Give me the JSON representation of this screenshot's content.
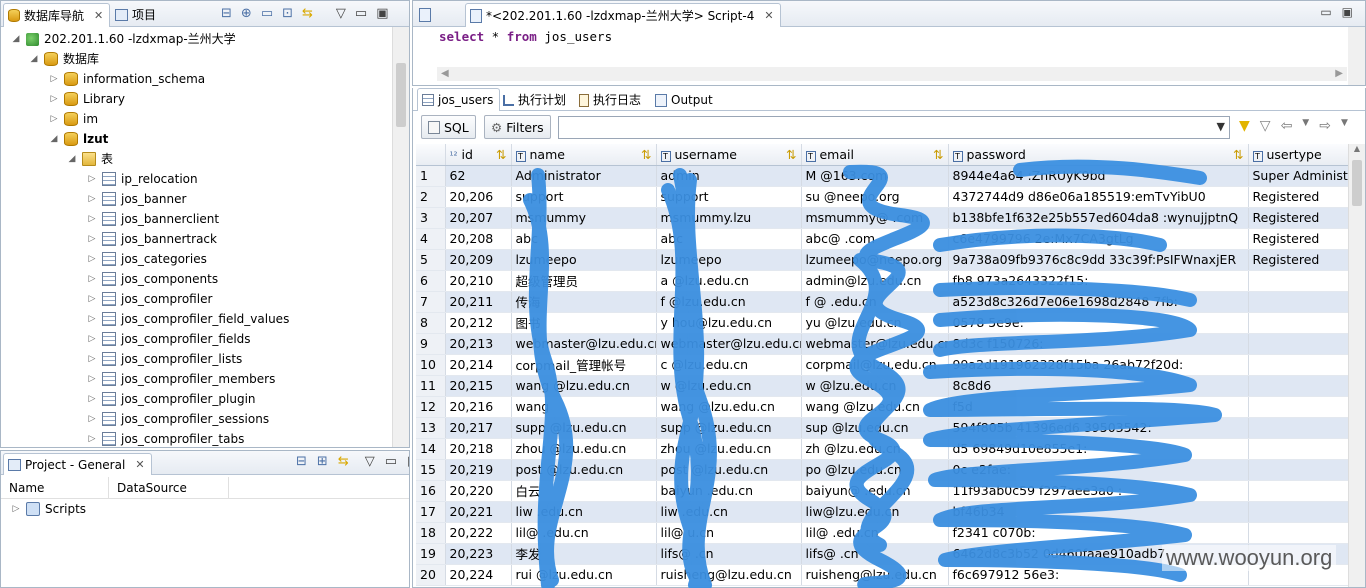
{
  "nav": {
    "tab1": "数据库导航",
    "tab2": "项目",
    "connection": "202.201.1.60 -lzdxmap-兰州大学",
    "databases_folder": "数据库",
    "dbs": [
      "information_schema",
      "Library",
      "im",
      "lzut"
    ],
    "tables_folder": "表",
    "tables": [
      "ip_relocation",
      "jos_banner",
      "jos_bannerclient",
      "jos_bannertrack",
      "jos_categories",
      "jos_components",
      "jos_comprofiler",
      "jos_comprofiler_field_values",
      "jos_comprofiler_fields",
      "jos_comprofiler_lists",
      "jos_comprofiler_members",
      "jos_comprofiler_plugin",
      "jos_comprofiler_sessions",
      "jos_comprofiler_tabs"
    ]
  },
  "project": {
    "title": "Project - General",
    "col_name": "Name",
    "col_ds": "DataSource",
    "item": "Scripts"
  },
  "editor": {
    "tab": "*<202.201.1.60 -lzdxmap-兰州大学> Script-4",
    "sql_kw1": "select",
    "sql_mid": " * ",
    "sql_kw2": "from",
    "sql_tbl": " jos_users"
  },
  "result_tabs": [
    "jos_users",
    "执行计划",
    "执行日志",
    "Output"
  ],
  "toolbar": {
    "sql": "SQL",
    "filters": "Filters"
  },
  "grid": {
    "columns": [
      "id",
      "name",
      "username",
      "email",
      "password",
      "usertype"
    ],
    "rows": [
      [
        "1",
        "62",
        "Administrator",
        "admin",
        "M         @163.com",
        "8944e4a64          :ZnRUyK9bd",
        "Super Administra"
      ],
      [
        "2",
        "20,206",
        "support",
        "support",
        "su       @neepo.org",
        "4372744d9         d86e06a185519:emTvYibU0",
        "Registered"
      ],
      [
        "3",
        "20,207",
        "msmummy",
        "msmummy.lzu",
        "msmummy@      .com",
        "b138bfe1f632e25b557ed604da8     :wynujjptnQ",
        "Registered"
      ],
      [
        "4",
        "20,208",
        "abc",
        "abc",
        "abc@     .com",
        "c6e4799796    2e:Mx7CA3gtLg",
        "Registered"
      ],
      [
        "5",
        "20,209",
        "lzumeepo",
        "lzumeepo",
        "lzumeepo@neepo.org",
        "9a738a09fb9376c8c9dd    33c39f:PsIFWnaxjER",
        "Registered"
      ],
      [
        "6",
        "20,210",
        "超级管理员",
        "a      @lzu.edu.cn",
        "admin@lzu.edu.cn",
        "fb8     973a2643322f15:",
        ""
      ],
      [
        "7",
        "20,211",
        "传海",
        "f     @lzu.edu.cn",
        "f    @    .edu.cn",
        "a523d8c326d7e06e1698d2848   7fb:",
        ""
      ],
      [
        "8",
        "20,212",
        "图书",
        "y     hou@lzu.edu.cn",
        "yu     @lzu.edu.cn",
        "0578    5e9e:",
        ""
      ],
      [
        "9",
        "20,213",
        "webmaster@lzu.edu.cn",
        "webmaster@lzu.edu.cn",
        "webmaster@lzu.edu.cn",
        "8d3c     f150726:",
        ""
      ],
      [
        "10",
        "20,214",
        "corpmail_管理帐号",
        "c    @lzu.edu.cn",
        "corpmail@lzu.edu.cn",
        "99a2d191962328f15ba   26ab72f20d:",
        ""
      ],
      [
        "11",
        "20,215",
        "wang    @lzu.edu.cn",
        "w      @lzu.edu.cn",
        "w      @lzu.edu.cn",
        "8c8d6     ",
        ""
      ],
      [
        "12",
        "20,216",
        "wang",
        "wang    @lzu.edu.cn",
        "wang    @lzu.edu.cn",
        "f5d     ",
        ""
      ],
      [
        "13",
        "20,217",
        "supp    @lzu.edu.cn",
        "supp    @lzu.edu.cn",
        "sup    @lzu.edu.cn",
        "594f805b   41396ed6    39503542:",
        ""
      ],
      [
        "14",
        "20,218",
        "zhou    @lzu.edu.cn",
        "zhou    @lzu.edu.cn",
        "zh    @lzu.edu.cn",
        "d5     69849d10e855e1:",
        ""
      ],
      [
        "15",
        "20,219",
        "post    @lzu.edu.cn",
        "post    @lzu.edu.cn",
        "po    @lzu.edu.cn",
        "0c    e2fae:",
        ""
      ],
      [
        "16",
        "20,220",
        "白云",
        "baiyun     .edu.cn",
        "baiyun@    .edu.cn",
        "11f93ab0c59    f297aee3a0   :",
        ""
      ],
      [
        "17",
        "20,221",
        "liw    .edu.cn",
        "liw    .edu.cn",
        "liw@lzu.edu.cn",
        "bf46b34   ",
        ""
      ],
      [
        "18",
        "20,222",
        "lil@    .edu.cn",
        "lil@    u.cn",
        "lil@    .edu.cn",
        "f2341     c070b:",
        ""
      ],
      [
        "19",
        "20,223",
        "李发",
        "lifs@    .cn",
        "lifs@    .cn",
        "6462d8c3b52    0d460faae910adb7",
        ""
      ],
      [
        "20",
        "20,224",
        "rui    @lzu.edu.cn",
        "ruisheng@lzu.edu.cn",
        "ruisheng@lzu.edu.cn",
        "    f6c697912    56e3:",
        ""
      ]
    ]
  },
  "watermark": "www.wooyun.org"
}
